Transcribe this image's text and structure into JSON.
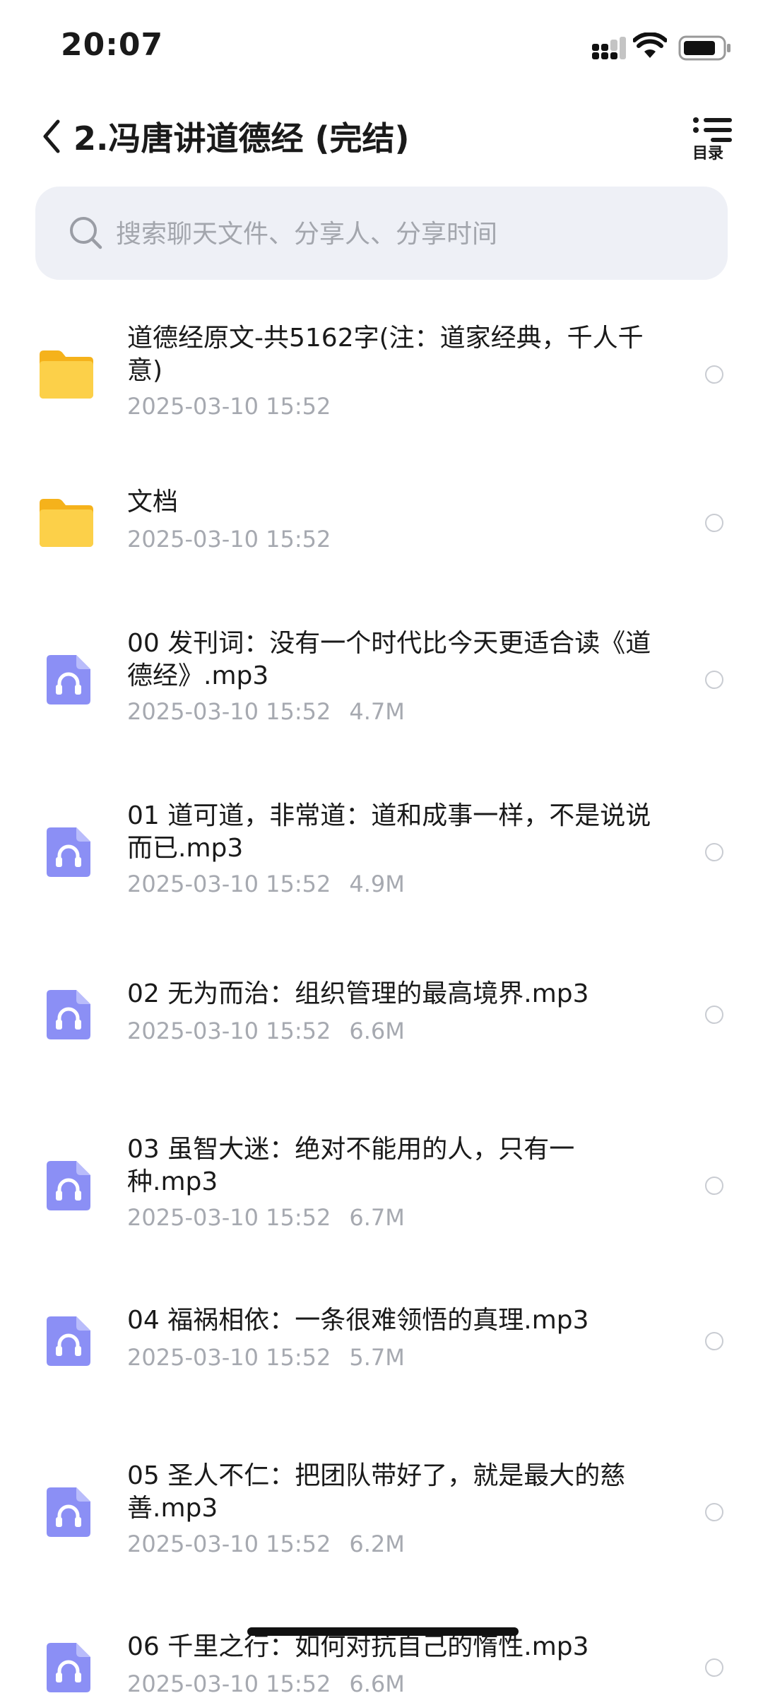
{
  "status_bar": {
    "time": "20:07"
  },
  "nav": {
    "title": "2.冯唐讲道德经 (完结)",
    "toc_label": "目录"
  },
  "search": {
    "placeholder": "搜索聊天文件、分享人、分享时间"
  },
  "items": [
    {
      "type": "folder",
      "name": "道德经原文-共5162字(注：道家经典，千人千意)",
      "date": "2025-03-10 15:52",
      "size": ""
    },
    {
      "type": "folder",
      "name": "文档",
      "date": "2025-03-10 15:52",
      "size": ""
    },
    {
      "type": "audio",
      "name": "00 发刊词：没有一个时代比今天更适合读《道德经》.mp3",
      "date": "2025-03-10 15:52",
      "size": "4.7M"
    },
    {
      "type": "audio",
      "name": "01 道可道，非常道：道和成事一样，不是说说而已.mp3",
      "date": "2025-03-10 15:52",
      "size": "4.9M"
    },
    {
      "type": "audio",
      "name": "02 无为而治：组织管理的最高境界.mp3",
      "date": "2025-03-10 15:52",
      "size": "6.6M"
    },
    {
      "type": "audio",
      "name": "03 虽智大迷：绝对不能用的人，只有一种.mp3",
      "date": "2025-03-10 15:52",
      "size": "6.7M"
    },
    {
      "type": "audio",
      "name": "04 福祸相依：一条很难领悟的真理.mp3",
      "date": "2025-03-10 15:52",
      "size": "5.7M"
    },
    {
      "type": "audio",
      "name": "05 圣人不仁：把团队带好了，就是最大的慈善.mp3",
      "date": "2025-03-10 15:52",
      "size": "6.2M"
    },
    {
      "type": "audio",
      "name": "06 千里之行：如何对抗自己的惰性.mp3",
      "date": "2025-03-10 15:52",
      "size": "6.6M"
    }
  ],
  "icons": {
    "folder": "folder-icon",
    "audio": "audio-file-icon",
    "search": "search-icon",
    "back": "back-chevron-icon",
    "toc": "list-icon"
  },
  "colors": {
    "folder": "#fbc42c",
    "audio": "#8b8ff5",
    "search_bg": "#eef0f6",
    "meta_text": "#a6a9b0"
  }
}
